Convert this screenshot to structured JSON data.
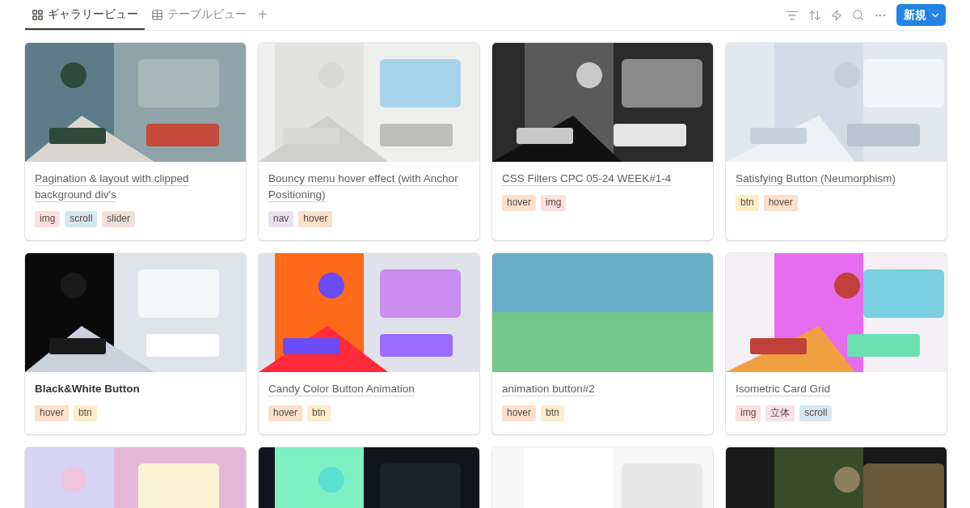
{
  "tabs": [
    {
      "label": "ギャラリービュー",
      "kind": "gallery",
      "selected": true
    },
    {
      "label": "テーブルビュー",
      "kind": "table",
      "selected": false
    }
  ],
  "add_view": "+",
  "new_button": {
    "label": "新規"
  },
  "cards": [
    {
      "picture": {
        "kind": "picture"
      },
      "title": "Pagination & layout with clipped background div's",
      "linked": true,
      "tags": [
        {
          "label": "img",
          "color": "#fbe0e0"
        },
        {
          "label": "scroll",
          "color": "#d6e7f1"
        },
        {
          "label": "slider",
          "color": "#efe2dc"
        }
      ]
    },
    {
      "picture": {
        "kind": "picture"
      },
      "title": "Bouncy menu hover effect (with Anchor Positioning)",
      "linked": true,
      "tags": [
        {
          "label": "nav",
          "color": "#e9e0f0"
        },
        {
          "label": "hover",
          "color": "#fbe0cc"
        }
      ]
    },
    {
      "picture": {
        "kind": "picture"
      },
      "title": "CSS Filters CPC 05-24 WEEK#1-4",
      "linked": true,
      "tags": [
        {
          "label": "hover",
          "color": "#fbe0cc"
        },
        {
          "label": "img",
          "color": "#fbe0e0"
        }
      ]
    },
    {
      "picture": {
        "kind": "picture"
      },
      "title": "Satisfying Button (Neumorphism)",
      "linked": true,
      "tags": [
        {
          "label": "btn",
          "color": "#fcedcb"
        },
        {
          "label": "hover",
          "color": "#fbe0cc"
        }
      ]
    },
    {
      "picture": {
        "kind": "picture"
      },
      "title": "Black&White Button",
      "linked": false,
      "tags": [
        {
          "label": "hover",
          "color": "#fbe0cc"
        },
        {
          "label": "btn",
          "color": "#fcedcb"
        }
      ]
    },
    {
      "picture": {
        "kind": "picture"
      },
      "title": "Candy Color Button Animation",
      "linked": true,
      "tags": [
        {
          "label": "hover",
          "color": "#fbe0cc"
        },
        {
          "label": "btn",
          "color": "#fcedcb"
        }
      ]
    },
    {
      "picture": {
        "kind": "picture"
      },
      "title": "animation button#2",
      "linked": true,
      "tags": [
        {
          "label": "hover",
          "color": "#fbe0cc"
        },
        {
          "label": "btn",
          "color": "#fcedcb"
        }
      ]
    },
    {
      "picture": {
        "kind": "picture"
      },
      "title": "Isometric Card Grid",
      "linked": true,
      "tags": [
        {
          "label": "img",
          "color": "#fbe0e0"
        },
        {
          "label": "立体",
          "color": "#f6e1eb"
        },
        {
          "label": "scroll",
          "color": "#d6e7f1"
        }
      ]
    },
    {
      "picture": {
        "kind": "picture"
      }
    },
    {
      "picture": {
        "kind": "picture"
      }
    },
    {
      "picture": {
        "kind": "picture"
      }
    },
    {
      "picture": {
        "kind": "picture"
      }
    }
  ]
}
